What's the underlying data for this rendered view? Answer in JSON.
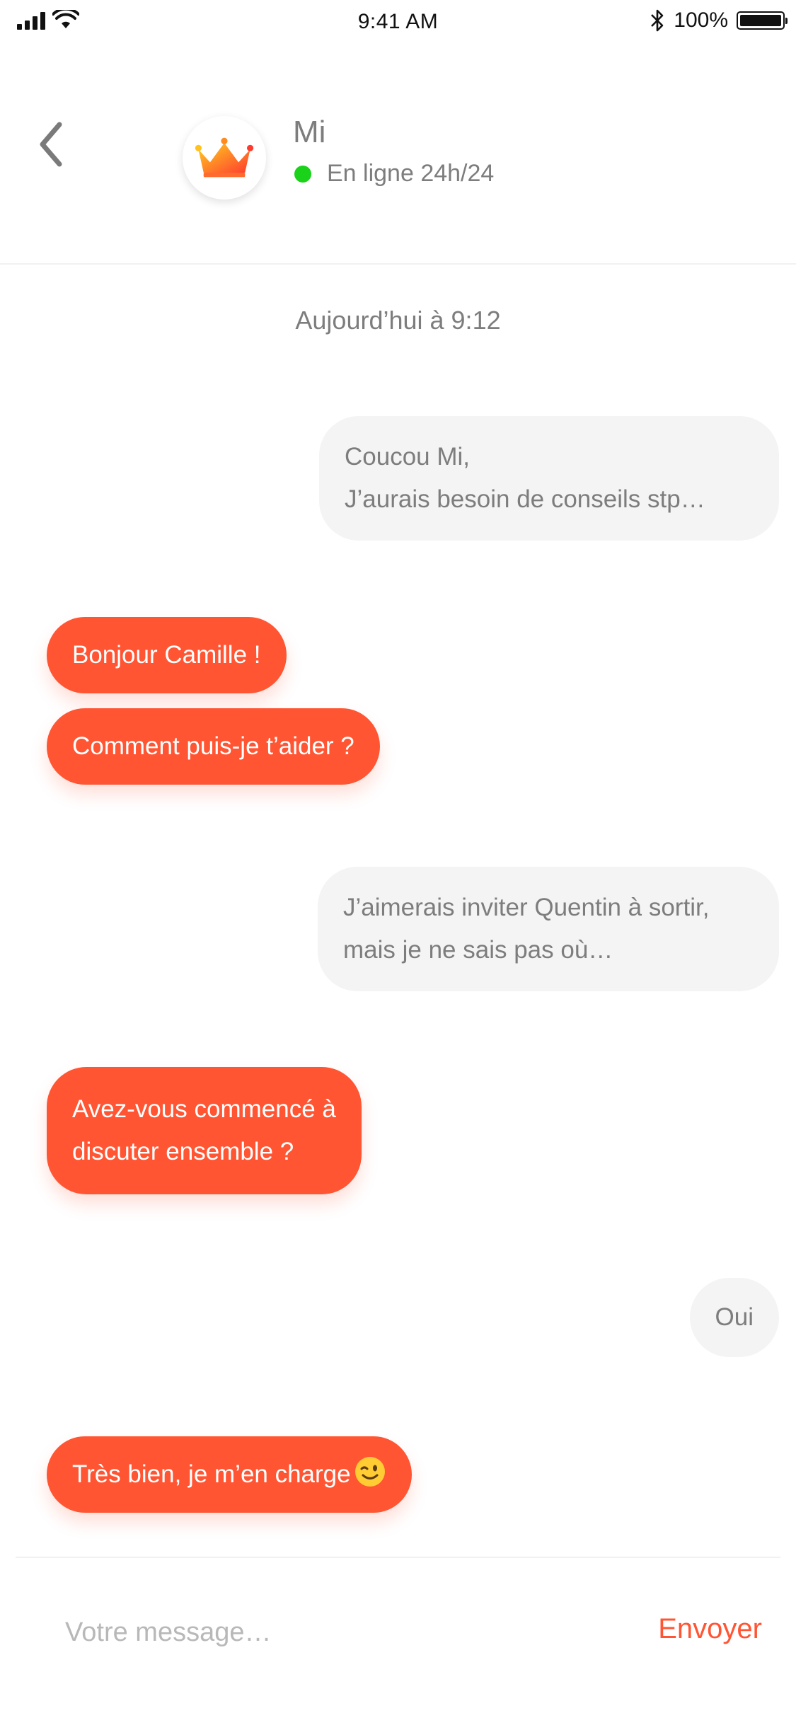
{
  "status_bar": {
    "time": "9:41 AM",
    "battery": "100%",
    "battery_level": 1.0,
    "icons": [
      "cellular-signal-icon",
      "wifi-icon",
      "bluetooth-icon",
      "battery-icon"
    ]
  },
  "header": {
    "back_icon": "chevron-left-icon",
    "avatar_icon": "crown-icon",
    "contact_name": "Mi",
    "presence": "En ligne 24h/24",
    "presence_color": "#1bd21b"
  },
  "conversation": {
    "date_separator": "Aujourd’hui à 9:12",
    "messages": [
      {
        "from": "user",
        "lines": [
          "Coucou Mi,",
          "J’aurais besoin de conseils stp…"
        ]
      },
      {
        "from": "bot",
        "lines": [
          "Bonjour Camille !"
        ]
      },
      {
        "from": "bot",
        "lines": [
          "Comment puis-je t’aider ?"
        ]
      },
      {
        "from": "user",
        "lines": [
          "J’aimerais inviter Quentin à sortir,",
          "mais je ne sais pas où…"
        ]
      },
      {
        "from": "bot",
        "lines": [
          "Avez-vous commencé à",
          "discuter ensemble ?"
        ]
      },
      {
        "from": "user",
        "lines": [
          "Oui"
        ]
      },
      {
        "from": "bot",
        "lines": [
          "Très bien, je m’en charge"
        ],
        "emoji": "winking-face-emoji"
      }
    ]
  },
  "composer": {
    "placeholder": "Votre message…",
    "value": "",
    "send_label": "Envoyer"
  },
  "colors": {
    "accent": "#ff5533",
    "user_bubble": "#f4f4f4",
    "text_gray": "#7d7d7d"
  }
}
